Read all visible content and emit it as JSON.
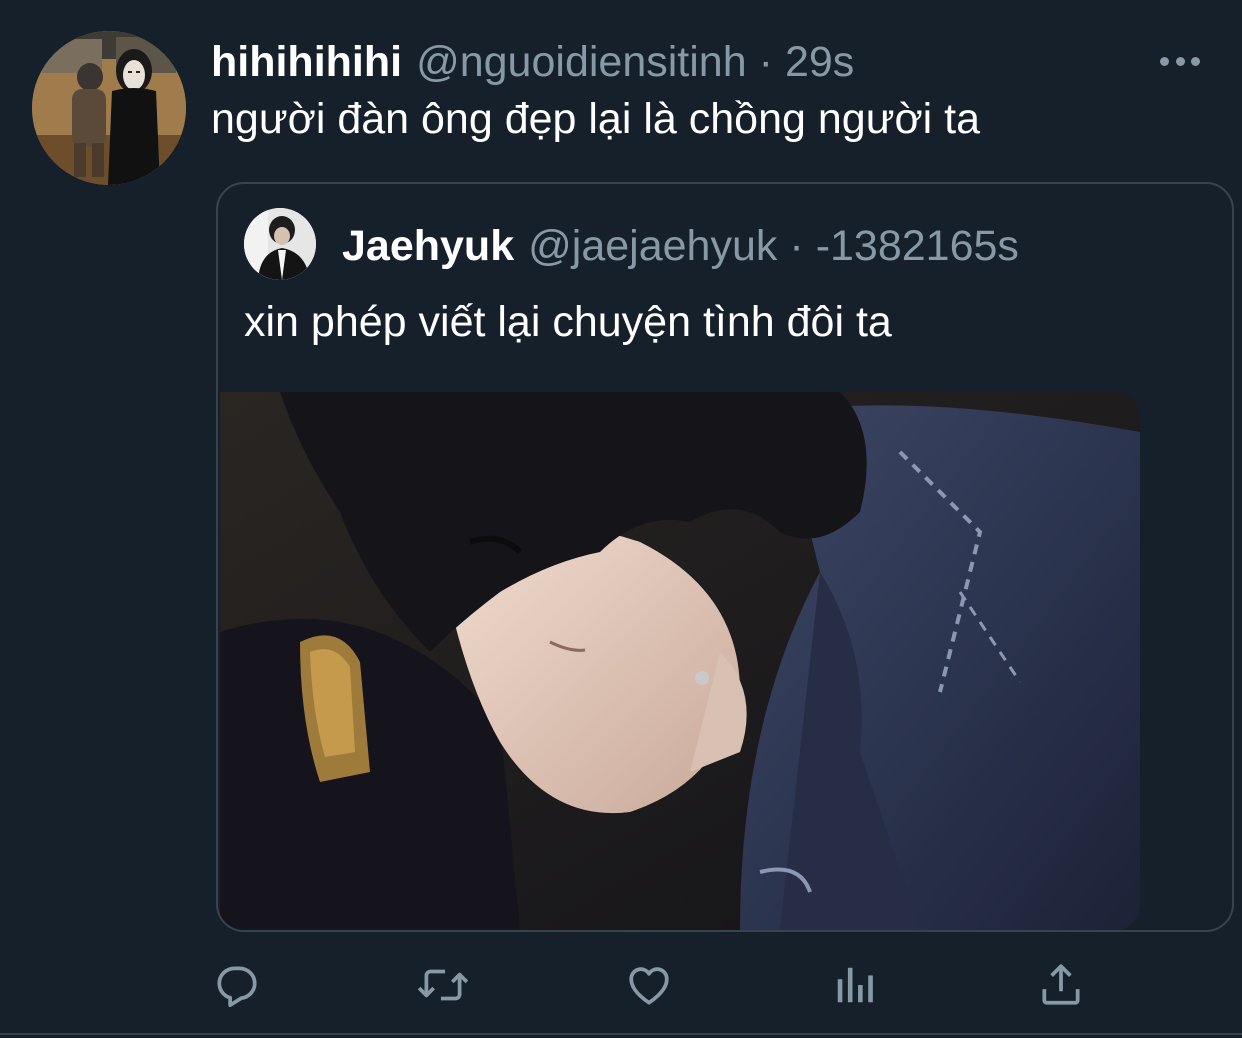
{
  "tweet": {
    "display_name": "hihihihihi",
    "handle": "@nguoidiensitinh",
    "separator": "·",
    "time": "29s",
    "text": "người đàn ông đẹp lại là chồng người ta",
    "avatar_icon": "profile-photo"
  },
  "quoted": {
    "display_name": "Jaehyuk",
    "handle": "@jaejaehyuk",
    "separator": "·",
    "time": "-1382165s",
    "text": "xin phép viết lại chuyện tình đôi ta",
    "media_icon": "photo"
  },
  "actions": [
    {
      "icon": "reply-icon"
    },
    {
      "icon": "retweet-icon"
    },
    {
      "icon": "like-icon"
    },
    {
      "icon": "analytics-icon"
    },
    {
      "icon": "share-icon"
    }
  ],
  "colors": {
    "background": "#15202b",
    "text": "#ffffff",
    "secondary_text": "#8899a6",
    "border": "#38444d"
  }
}
